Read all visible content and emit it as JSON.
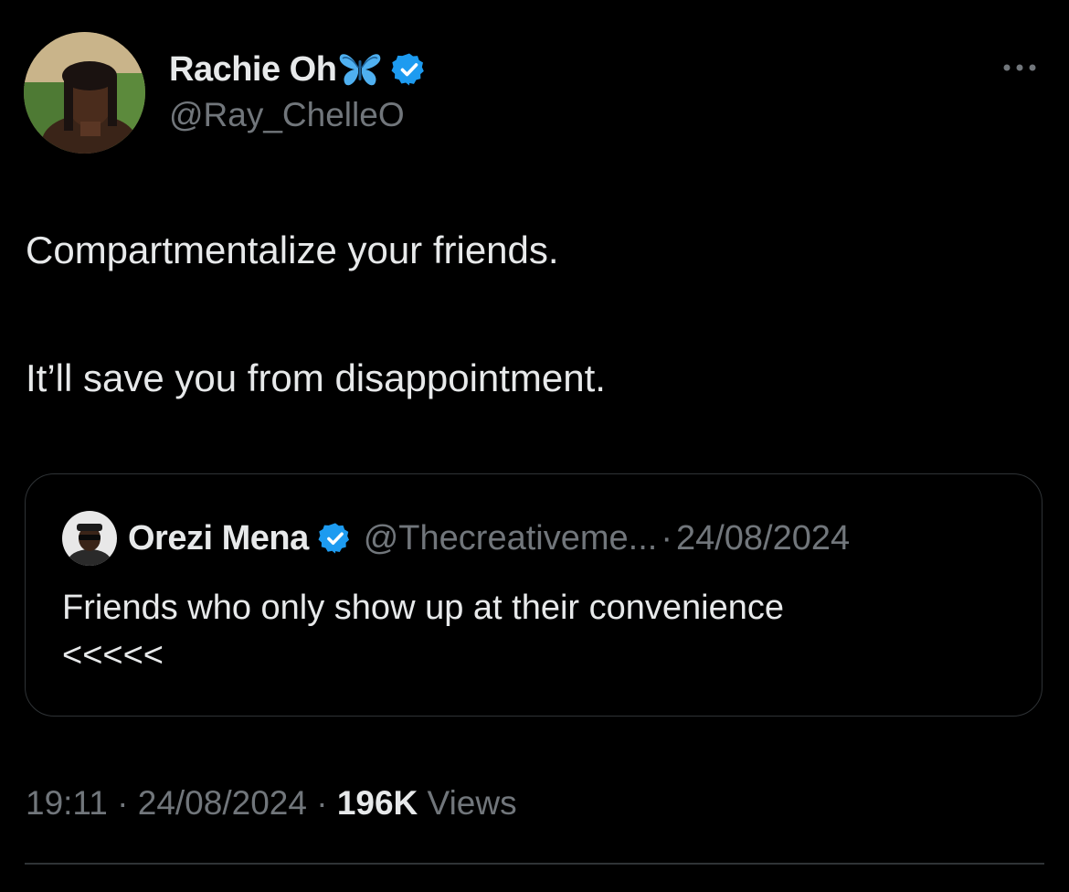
{
  "tweet": {
    "author": {
      "display_name": "Rachie Oh",
      "handle": "@Ray_ChelleO",
      "name_emoji": "butterfly-icon",
      "verified": true
    },
    "text_line_1": "Compartmentalize your friends.",
    "text_line_2": "It’ll save you from disappointment.",
    "quote": {
      "display_name": "Orezi Mena",
      "handle": "@Thecreativeme...",
      "separator": "·",
      "date": "24/08/2024",
      "text_line_1": "Friends who only show up at their convenience",
      "text_line_2": "<<<<<",
      "verified": true
    },
    "meta": {
      "time": "19:11",
      "separator": " · ",
      "date": "24/08/2024",
      "views_count": "196K",
      "views_label": " Views"
    }
  },
  "colors": {
    "background": "#000000",
    "primary_text": "#e7e9ea",
    "secondary_text": "#71767b",
    "border": "#2f3336",
    "verified_blue": "#1d9bf0",
    "butterfly_blue": "#4fb0f0"
  }
}
